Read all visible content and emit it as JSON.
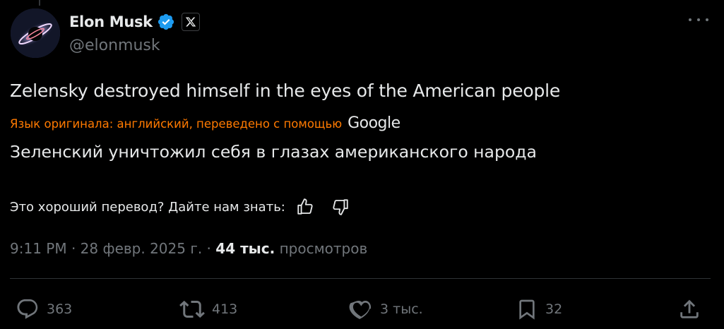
{
  "author": {
    "display_name": "Elon Musk",
    "handle": "@elonmusk",
    "verified": true,
    "affiliate_badge_icon": "x-logo-icon"
  },
  "tweet": {
    "text": "Zelensky destroyed himself in the eyes of the American people",
    "translation_note": "Язык оригинала: английский, переведено с помощью",
    "translation_provider": "Google",
    "translated_text": "Зеленский уничтожил себя в глазах американского народа"
  },
  "feedback": {
    "question": "Это хороший перевод? Дайте нам знать:"
  },
  "meta": {
    "time": "9:11 PM",
    "separator": " · ",
    "date": "28 февр. 2025 г.",
    "views_count": "44 тыс.",
    "views_label": "просмотров"
  },
  "actions": {
    "replies": "363",
    "reposts": "413",
    "likes": "3 тыс.",
    "bookmarks": "32"
  },
  "colors": {
    "background": "#000000",
    "text": "#e7e9ea",
    "secondary": "#71767b",
    "verified": "#1d9bf0",
    "translation_note": "#ff7a00",
    "divider": "#2f3336"
  }
}
